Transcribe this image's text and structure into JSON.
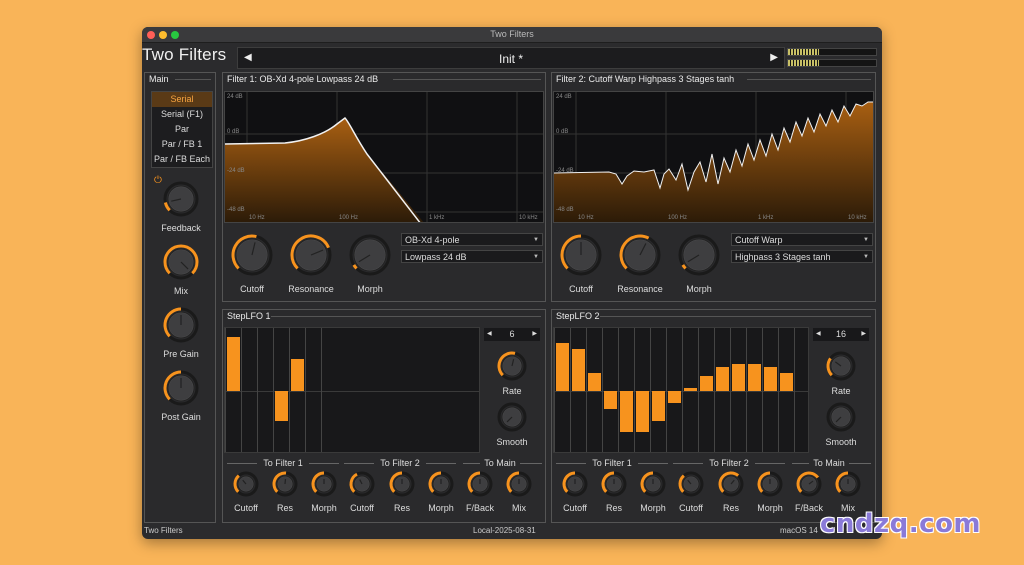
{
  "window": {
    "title": "Two Filters"
  },
  "app_title": "Two Filters",
  "preset": {
    "name": "Init *",
    "prev": "◀",
    "next": "▶"
  },
  "meters": [
    {
      "level": 0.35
    },
    {
      "level": 0.35
    }
  ],
  "main": {
    "title": "Main",
    "modes": [
      "Serial",
      "Serial (F1)",
      "Par",
      "Par / FB 1",
      "Par / FB Each"
    ],
    "selected": "Serial",
    "power_icon": "⏻",
    "knobs": [
      {
        "label": "Feedback",
        "value": 0.12
      },
      {
        "label": "Mix",
        "value": 1.0
      },
      {
        "label": "Pre Gain",
        "value": 0.5
      },
      {
        "label": "Post Gain",
        "value": 0.5
      }
    ]
  },
  "filter1": {
    "title": "Filter 1: OB-Xd 4-pole Lowpass 24 dB",
    "db_labels": [
      "24 dB",
      "0 dB",
      "-24 dB",
      "-48 dB"
    ],
    "freq_labels": [
      "10 Hz",
      "100 Hz",
      "1 kHz",
      "10 kHz"
    ],
    "knobs": [
      {
        "label": "Cutoff",
        "value": 0.55
      },
      {
        "label": "Resonance",
        "value": 0.75
      },
      {
        "label": "Morph",
        "value": 0.05
      }
    ],
    "type_select": "OB-Xd 4-pole",
    "mode_select": "Lowpass 24 dB"
  },
  "filter2": {
    "title": "Filter 2: Cutoff Warp Highpass 3 Stages tanh",
    "db_labels": [
      "24 dB",
      "0 dB",
      "-24 dB",
      "-48 dB"
    ],
    "freq_labels": [
      "10 Hz",
      "100 Hz",
      "1 kHz",
      "10 kHz"
    ],
    "knobs": [
      {
        "label": "Cutoff",
        "value": 0.5
      },
      {
        "label": "Resonance",
        "value": 0.6
      },
      {
        "label": "Morph",
        "value": 0.05
      }
    ],
    "type_select": "Cutoff Warp",
    "mode_select": "Highpass 3 Stages tanh"
  },
  "lfo1": {
    "title": "StepLFO 1",
    "steps": 6,
    "step_values": [
      0.92,
      0,
      0,
      -0.5,
      0.55,
      0
    ],
    "rate": {
      "label": "Rate",
      "value": 0.55
    },
    "smooth": {
      "label": "Smooth",
      "value": 0.0
    },
    "sections": [
      "To Filter 1",
      "To Filter 2",
      "To Main"
    ],
    "targets": [
      {
        "label": "Cutoff",
        "value": 0.35
      },
      {
        "label": "Res",
        "value": 0.52
      },
      {
        "label": "Morph",
        "value": 0.5
      },
      {
        "label": "Cutoff",
        "value": 0.4
      },
      {
        "label": "Res",
        "value": 0.5
      },
      {
        "label": "Morph",
        "value": 0.5
      },
      {
        "label": "F/Back",
        "value": 0.5
      },
      {
        "label": "Mix",
        "value": 0.5
      }
    ]
  },
  "lfo2": {
    "title": "StepLFO 2",
    "steps": 16,
    "step_values": [
      0.82,
      0.72,
      0.3,
      -0.3,
      -0.7,
      -0.7,
      -0.5,
      -0.2,
      0.05,
      0.25,
      0.4,
      0.45,
      0.45,
      0.4,
      0.3,
      0
    ],
    "rate": {
      "label": "Rate",
      "value": 0.3
    },
    "smooth": {
      "label": "Smooth",
      "value": 0.0
    },
    "sections": [
      "To Filter 1",
      "To Filter 2",
      "To Main"
    ],
    "targets": [
      {
        "label": "Cutoff",
        "value": 0.5
      },
      {
        "label": "Res",
        "value": 0.5
      },
      {
        "label": "Morph",
        "value": 0.5
      },
      {
        "label": "Cutoff",
        "value": 0.35
      },
      {
        "label": "Res",
        "value": 0.65
      },
      {
        "label": "Morph",
        "value": 0.5
      },
      {
        "label": "F/Back",
        "value": 0.7
      },
      {
        "label": "Mix",
        "value": 0.5
      }
    ]
  },
  "footer": {
    "left": "Two Filters",
    "center": "Local-2025-08-31",
    "right": "macOS 14"
  },
  "watermark": "cndzq.com",
  "colors": {
    "accent": "#f7931e",
    "panel_border": "#555555",
    "background": "#f9b458"
  }
}
